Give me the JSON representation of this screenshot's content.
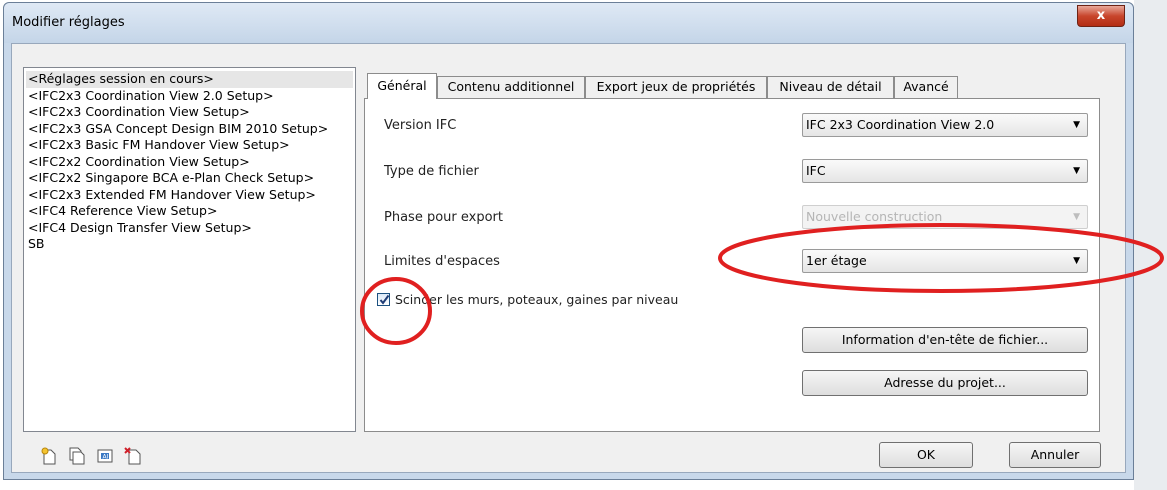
{
  "window": {
    "title": "Modifier réglages",
    "close_label": "x"
  },
  "setups": {
    "items": [
      "<Réglages session en cours>",
      "<IFC2x3 Coordination View 2.0 Setup>",
      "<IFC2x3 Coordination View Setup>",
      "<IFC2x3 GSA Concept Design BIM 2010 Setup>",
      "<IFC2x3 Basic FM Handover View Setup>",
      "<IFC2x2 Coordination View Setup>",
      "<IFC2x2 Singapore BCA e-Plan Check Setup>",
      "<IFC2x3 Extended FM Handover View Setup>",
      "<IFC4 Reference View Setup>",
      "<IFC4 Design Transfer View Setup>",
      "SB"
    ],
    "selected_index": 0
  },
  "tabs": [
    "Général",
    "Contenu additionnel",
    "Export jeux de propriétés",
    "Niveau de détail",
    "Avancé"
  ],
  "general": {
    "version_label": "Version IFC",
    "version_value": "IFC 2x3 Coordination View 2.0",
    "filetype_label": "Type de fichier",
    "filetype_value": "IFC",
    "phase_label": "Phase pour export",
    "phase_value": "Nouvelle construction",
    "space_label": "Limites d'espaces",
    "space_value": "1er étage",
    "split_label": "Scinder les murs, poteaux, gaines par niveau",
    "split_checked": true,
    "header_button": "Information d'en-tête de fichier...",
    "address_button": "Adresse du projet..."
  },
  "footer": {
    "ok": "OK",
    "cancel": "Annuler"
  },
  "icons": [
    "new-setup-icon",
    "duplicate-setup-icon",
    "rename-setup-icon",
    "delete-setup-icon"
  ],
  "colors": {
    "annotation": "#e02020",
    "title_bar": "#c8d8ea",
    "close_button": "#c8452c"
  }
}
